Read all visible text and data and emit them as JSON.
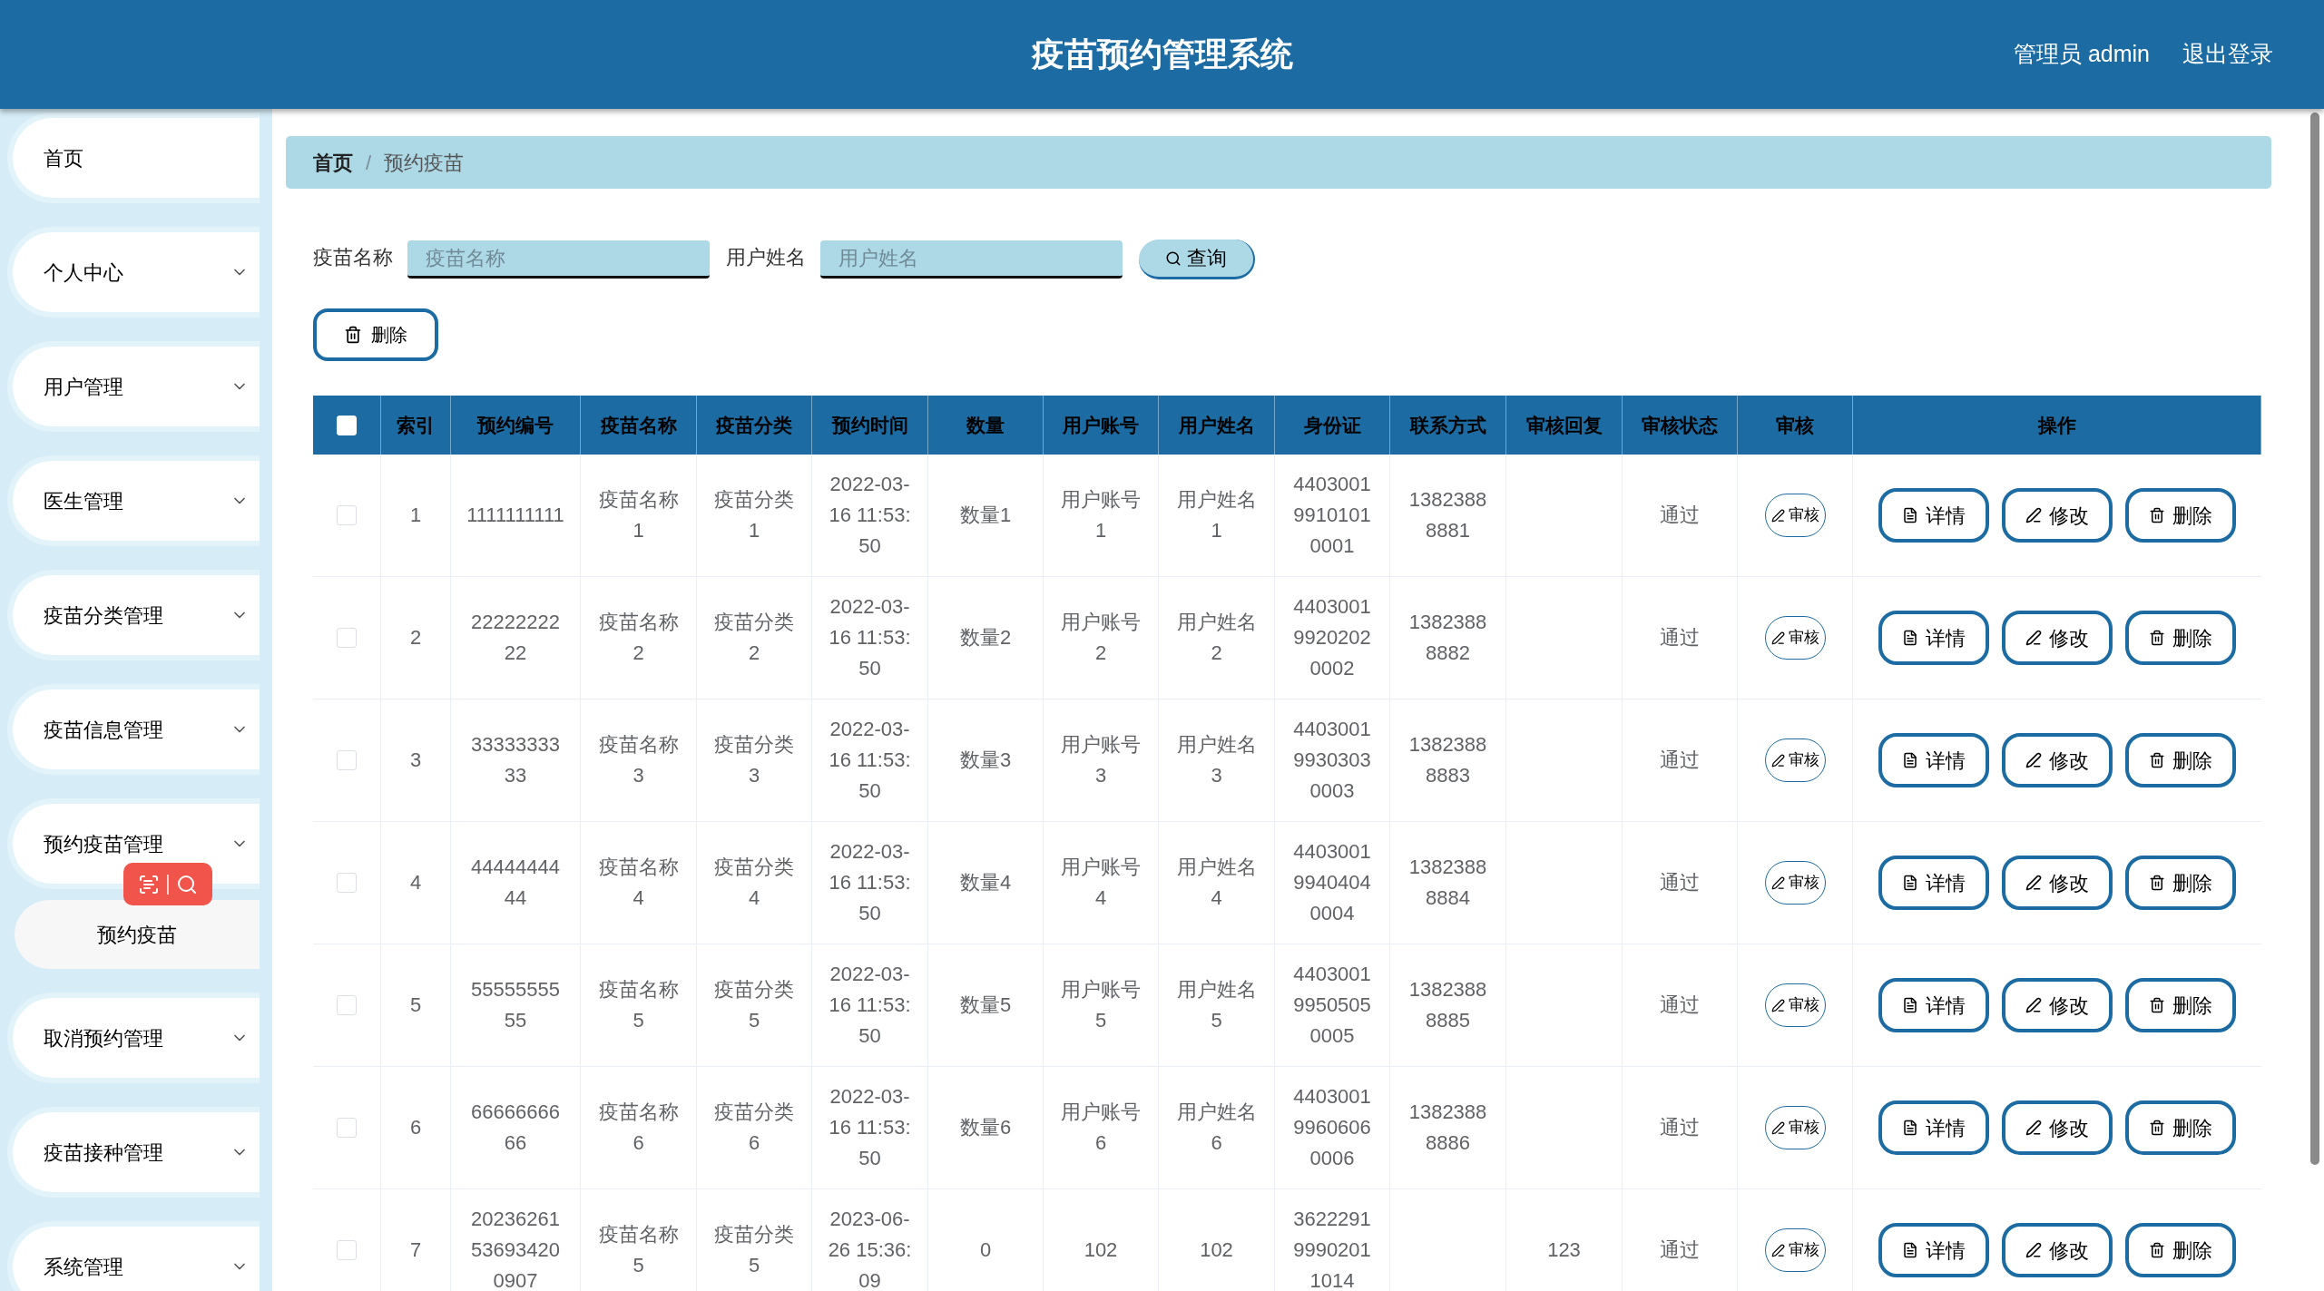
{
  "header": {
    "title": "疫苗预约管理系统",
    "user": "管理员 admin",
    "logout": "退出登录"
  },
  "sidebar": {
    "items": [
      {
        "label": "首页",
        "kind": "link"
      },
      {
        "label": "个人中心",
        "kind": "menu"
      },
      {
        "label": "用户管理",
        "kind": "menu"
      },
      {
        "label": "医生管理",
        "kind": "menu"
      },
      {
        "label": "疫苗分类管理",
        "kind": "menu"
      },
      {
        "label": "疫苗信息管理",
        "kind": "menu"
      },
      {
        "label": "预约疫苗管理",
        "kind": "menu",
        "children": [
          {
            "label": "预约疫苗",
            "selected": true
          }
        ]
      },
      {
        "label": "取消预约管理",
        "kind": "menu"
      },
      {
        "label": "疫苗接种管理",
        "kind": "menu"
      },
      {
        "label": "系统管理",
        "kind": "menu"
      }
    ]
  },
  "breadcrumb": {
    "separator": "/",
    "items": [
      {
        "label": "首页"
      },
      {
        "label": "预约疫苗"
      }
    ]
  },
  "search": {
    "fields": [
      {
        "label": "疫苗名称",
        "placeholder": "疫苗名称"
      },
      {
        "label": "用户姓名",
        "placeholder": "用户姓名"
      }
    ],
    "button": "查询"
  },
  "bulk_delete": "删除",
  "table": {
    "select_all": {
      "checked": false
    },
    "columns": [
      "索引",
      "预约编号",
      "疫苗名称",
      "疫苗分类",
      "预约时间",
      "数量",
      "用户账号",
      "用户姓名",
      "身份证",
      "联系方式",
      "审核回复",
      "审核状态",
      "审核",
      "操作"
    ],
    "rows": [
      {
        "checked": false,
        "cells": [
          "1",
          "1111111111",
          "疫苗名称1",
          "疫苗分类1",
          "2022-03-16 11:53:50",
          "数量1",
          "用户账号1",
          "用户姓名1",
          "440300199101010001",
          "13823888881",
          "",
          "通过"
        ],
        "review": "审核",
        "actions": [
          {
            "kind": "detail",
            "label": "详情"
          },
          {
            "kind": "edit",
            "label": "修改"
          },
          {
            "kind": "delete",
            "label": "删除"
          }
        ]
      },
      {
        "checked": false,
        "cells": [
          "2",
          "2222222222",
          "疫苗名称2",
          "疫苗分类2",
          "2022-03-16 11:53:50",
          "数量2",
          "用户账号2",
          "用户姓名2",
          "440300199202020002",
          "13823888882",
          "",
          "通过"
        ],
        "review": "审核",
        "actions": [
          {
            "kind": "detail",
            "label": "详情"
          },
          {
            "kind": "edit",
            "label": "修改"
          },
          {
            "kind": "delete",
            "label": "删除"
          }
        ]
      },
      {
        "checked": false,
        "cells": [
          "3",
          "3333333333",
          "疫苗名称3",
          "疫苗分类3",
          "2022-03-16 11:53:50",
          "数量3",
          "用户账号3",
          "用户姓名3",
          "440300199303030003",
          "13823888883",
          "",
          "通过"
        ],
        "review": "审核",
        "actions": [
          {
            "kind": "detail",
            "label": "详情"
          },
          {
            "kind": "edit",
            "label": "修改"
          },
          {
            "kind": "delete",
            "label": "删除"
          }
        ]
      },
      {
        "checked": false,
        "cells": [
          "4",
          "4444444444",
          "疫苗名称4",
          "疫苗分类4",
          "2022-03-16 11:53:50",
          "数量4",
          "用户账号4",
          "用户姓名4",
          "440300199404040004",
          "13823888884",
          "",
          "通过"
        ],
        "review": "审核",
        "actions": [
          {
            "kind": "detail",
            "label": "详情"
          },
          {
            "kind": "edit",
            "label": "修改"
          },
          {
            "kind": "delete",
            "label": "删除"
          }
        ]
      },
      {
        "checked": false,
        "cells": [
          "5",
          "5555555555",
          "疫苗名称5",
          "疫苗分类5",
          "2022-03-16 11:53:50",
          "数量5",
          "用户账号5",
          "用户姓名5",
          "440300199505050005",
          "13823888885",
          "",
          "通过"
        ],
        "review": "审核",
        "actions": [
          {
            "kind": "detail",
            "label": "详情"
          },
          {
            "kind": "edit",
            "label": "修改"
          },
          {
            "kind": "delete",
            "label": "删除"
          }
        ]
      },
      {
        "checked": false,
        "cells": [
          "6",
          "6666666666",
          "疫苗名称6",
          "疫苗分类6",
          "2022-03-16 11:53:50",
          "数量6",
          "用户账号6",
          "用户姓名6",
          "440300199606060006",
          "13823888886",
          "",
          "通过"
        ],
        "review": "审核",
        "actions": [
          {
            "kind": "detail",
            "label": "详情"
          },
          {
            "kind": "edit",
            "label": "修改"
          },
          {
            "kind": "delete",
            "label": "删除"
          }
        ]
      },
      {
        "checked": false,
        "cells": [
          "7",
          "20236261536934200907",
          "疫苗名称5",
          "疫苗分类5",
          "2023-06-26 15:36:09",
          "0",
          "102",
          "102",
          "362229199902011014",
          "",
          "123",
          "通过"
        ],
        "review": "审核",
        "actions": [
          {
            "kind": "detail",
            "label": "详情"
          },
          {
            "kind": "edit",
            "label": "修改"
          },
          {
            "kind": "delete",
            "label": "删除"
          }
        ]
      }
    ]
  }
}
